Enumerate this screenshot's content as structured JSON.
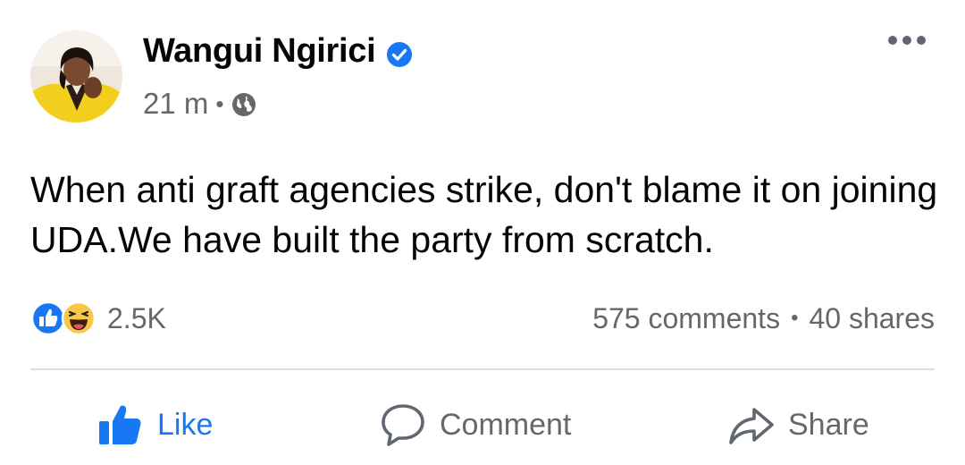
{
  "post": {
    "author": "Wangui Ngirici",
    "verified": true,
    "time": "21 m",
    "audience_icon": "globe-icon",
    "text": "When anti graft agencies strike, don't blame it on joining UDA.We have built the party from scratch."
  },
  "engagement": {
    "reaction_icons": [
      "like-reaction-icon",
      "haha-reaction-icon"
    ],
    "reaction_count": "2.5K",
    "comments": "575 comments",
    "separator": "•",
    "shares": "40 shares"
  },
  "actions": {
    "like": "Like",
    "comment": "Comment",
    "share": "Share"
  },
  "colors": {
    "brand_blue": "#1877f2",
    "secondary_text": "#65676b",
    "haha_yellow": "#f7c84b"
  }
}
